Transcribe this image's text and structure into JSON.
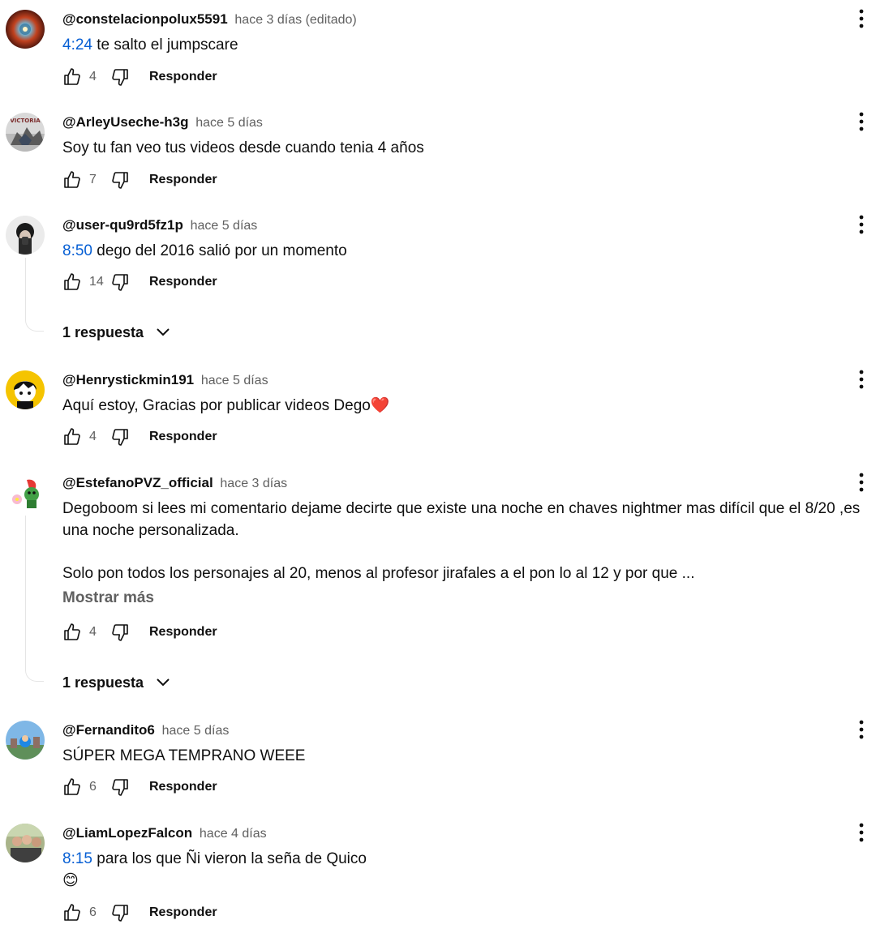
{
  "comments": [
    {
      "author": "@constelacionpolux5591",
      "time": "hace 3 días (editado)",
      "timestamp": "4:24",
      "text": "te salto el jumpscare",
      "likes": "4",
      "reply_label": "Responder",
      "avatar": "nebula-avatar"
    },
    {
      "author": "@ArleyUseche-h3g",
      "time": "hace 5 días",
      "text": "Soy tu fan veo tus videos desde cuando tenia 4 años",
      "likes": "7",
      "reply_label": "Responder",
      "avatar_text": "VICTORIA"
    },
    {
      "author": "@user-qu9rd5fz1p",
      "time": "hace 5 días",
      "timestamp": "8:50",
      "text": "dego del 2016 salió por un momento",
      "likes": "14",
      "reply_label": "Responder",
      "replies_label": "1 respuesta"
    },
    {
      "author": "@Henrystickmin191",
      "time": "hace 5 días",
      "text": "Aquí estoy, Gracias por publicar videos Dego❤️",
      "likes": "4",
      "reply_label": "Responder"
    },
    {
      "author": "@EstefanoPVZ_official",
      "time": "hace 3 días",
      "text_p1": "Degoboom si lees mi comentario dejame decirte que existe una noche en chaves nightmer mas difícil que el 8/20 ,es una noche personalizada.",
      "text_p2": "Solo pon todos los personajes al 20, menos al profesor jirafales a el pon lo al 12 y por que ...",
      "more_label": "Mostrar más",
      "likes": "4",
      "reply_label": "Responder",
      "replies_label": "1 respuesta"
    },
    {
      "author": "@Fernandito6",
      "time": "hace 5 días",
      "text": "SÚPER MEGA TEMPRANO WEEE",
      "likes": "6",
      "reply_label": "Responder"
    },
    {
      "author": "@LiamLopezFalcon",
      "time": "hace 4 días",
      "timestamp": "8:15",
      "text": "para los que Ñi vieron la seña de Quico",
      "text_line2": "😊",
      "likes": "6",
      "reply_label": "Responder"
    }
  ],
  "colors": {
    "timestamp_link": "#065fd4",
    "secondary_text": "#606060",
    "primary_text": "#0f0f0f"
  },
  "icons": [
    "thumb-up-icon",
    "thumb-down-icon",
    "more-vertical-icon",
    "chevron-down-icon"
  ]
}
